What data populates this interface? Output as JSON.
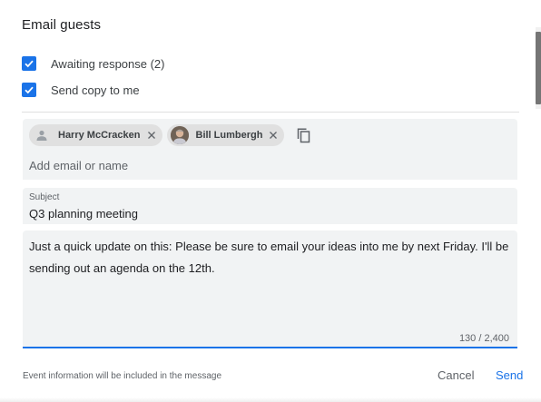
{
  "dialog": {
    "title": "Email guests"
  },
  "options": {
    "awaiting_response": {
      "label": "Awaiting response (2)",
      "checked": true
    },
    "send_copy": {
      "label": "Send copy to me",
      "checked": true
    }
  },
  "recipients": {
    "chips": [
      {
        "name": "Harry McCracken",
        "avatar": "person-icon"
      },
      {
        "name": "Bill Lumbergh",
        "avatar": "photo"
      }
    ],
    "copy_icon": "copy-icon",
    "placeholder": "Add email or name"
  },
  "subject": {
    "label": "Subject",
    "value": "Q3 planning meeting"
  },
  "message": {
    "body": "Just a quick update on this: Please be sure to email your ideas into me by next Friday. I'll be sending out an agenda on the 12th.",
    "char_count": "130 / 2,400"
  },
  "footer": {
    "note": "Event information will be included in the message",
    "cancel_label": "Cancel",
    "send_label": "Send"
  },
  "colors": {
    "accent": "#1a73e8",
    "field_bg": "#f1f3f4",
    "chip_bg": "#e0e0e0"
  }
}
